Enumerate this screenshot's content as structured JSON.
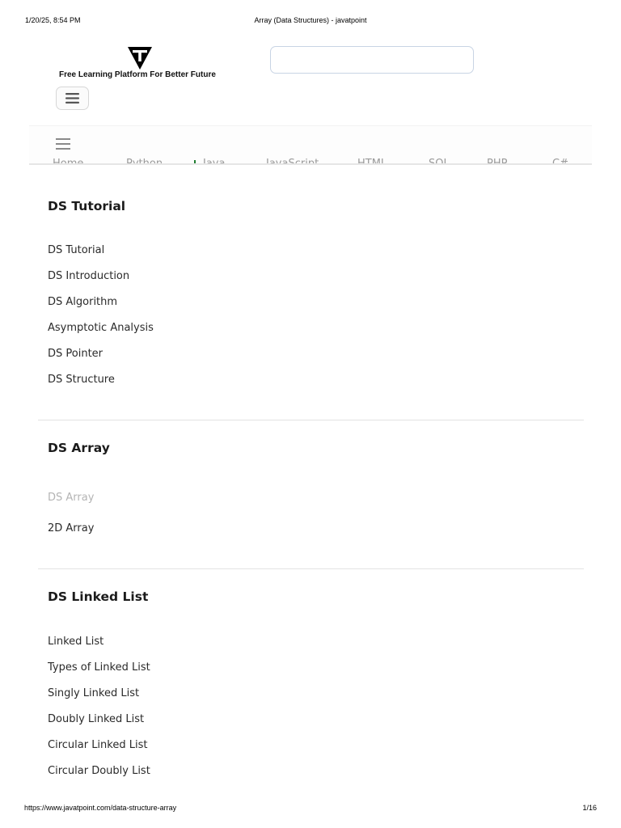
{
  "print_header": {
    "datetime": "1/20/25, 8:54 PM",
    "page_title": "Array (Data Structures) - javatpoint"
  },
  "brand": {
    "logo_icon": "javatpoint-t-logo-icon",
    "tagline": "Free Learning Platform For Better Future"
  },
  "search": {
    "value": "",
    "placeholder": ""
  },
  "menu_button": {
    "icon": "hamburger-menu-icon"
  },
  "top_nav": {
    "toggle_icon": "hamburger-menu-icon",
    "items": [
      {
        "label": "Home"
      },
      {
        "label": "Python"
      },
      {
        "label": "Java"
      },
      {
        "label": "JavaScript"
      },
      {
        "label": "HTML"
      },
      {
        "label": "SQL"
      },
      {
        "label": "PHP"
      },
      {
        "label": "C#"
      }
    ]
  },
  "sidebar": {
    "sections": [
      {
        "title": "DS Tutorial",
        "items": [
          {
            "label": "DS Tutorial"
          },
          {
            "label": "DS Introduction"
          },
          {
            "label": "DS Algorithm"
          },
          {
            "label": "Asymptotic Analysis"
          },
          {
            "label": "DS Pointer"
          },
          {
            "label": "DS Structure"
          }
        ]
      },
      {
        "title": "DS Array",
        "items": [
          {
            "label": "DS Array",
            "active": true
          },
          {
            "label": "2D Array"
          }
        ]
      },
      {
        "title": "DS Linked List",
        "items": [
          {
            "label": "Linked List"
          },
          {
            "label": "Types of Linked List"
          },
          {
            "label": "Singly Linked List"
          },
          {
            "label": "Doubly Linked List"
          },
          {
            "label": "Circular Linked List"
          },
          {
            "label": "Circular Doubly List"
          }
        ]
      }
    ]
  },
  "colors": {
    "active_link": "#b4b4b4",
    "nav_text": "#9a9a9a",
    "nav_marker": "#1e7d2f",
    "search_border": "#c8d4e4"
  },
  "print_footer": {
    "url": "https://www.javatpoint.com/data-structure-array",
    "page_number": "1/16"
  }
}
